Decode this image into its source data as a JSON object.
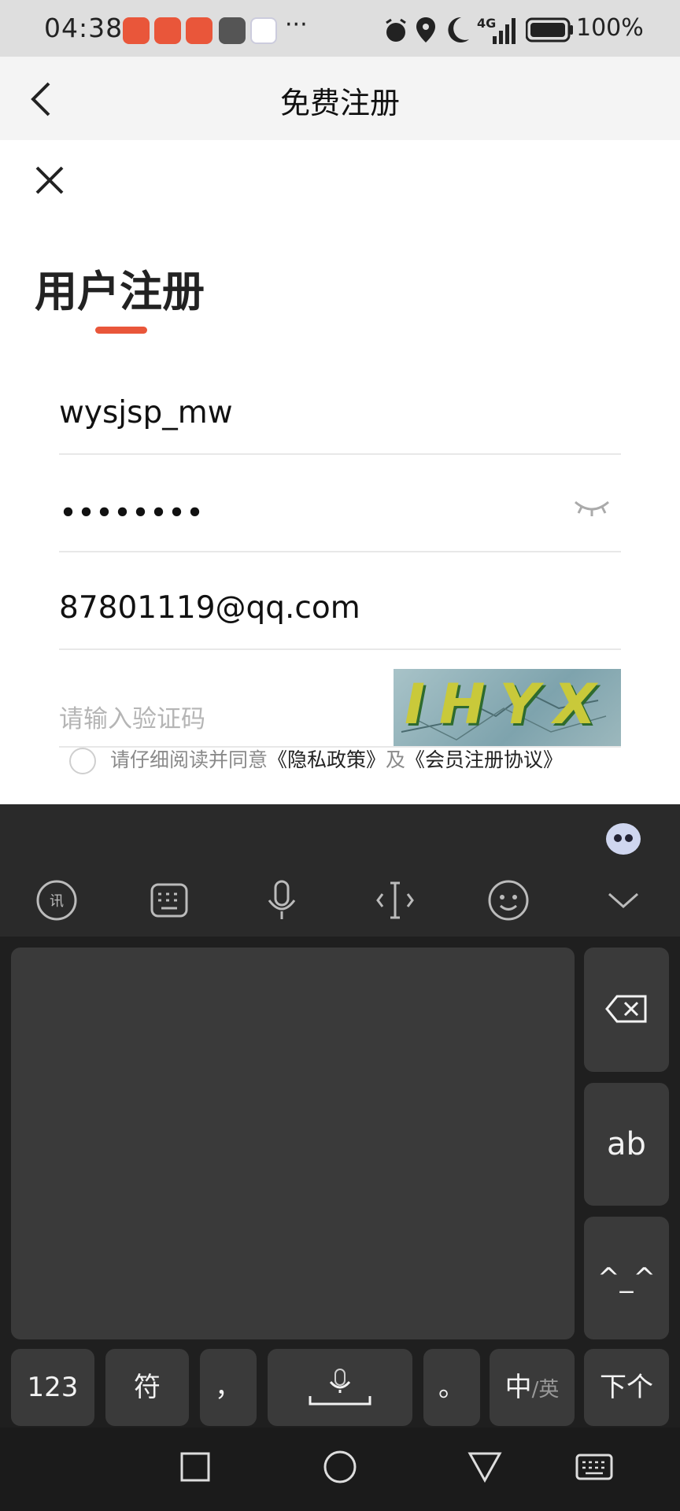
{
  "status_bar": {
    "time": "04:38",
    "more": "···",
    "network": "4G",
    "battery": "100%"
  },
  "title_bar": {
    "back_icon": "back-arrow-icon",
    "title": "免费注册"
  },
  "form": {
    "heading": "用户注册",
    "username": "wysjsp_mw",
    "password": "••••••••",
    "email": "87801119@qq.com",
    "captcha_placeholder": "请输入验证码",
    "captcha_text": "IHYX",
    "agreement": {
      "prefix": "请仔细阅读并同意",
      "privacy": "《隐私政策》",
      "and": "及",
      "member": "《会员注册协议》"
    }
  },
  "keyboard": {
    "toolbar": [
      "iflytek-icon",
      "keyboard-layout-icon",
      "microphone-icon",
      "cursor-icon",
      "emoji-icon",
      "collapse-icon"
    ],
    "keys": {
      "ab": "ab",
      "emoticon": "^_^",
      "num": "123",
      "symbol": "符",
      "comma": "，",
      "period": "。",
      "lang_primary": "中",
      "lang_secondary": "/英",
      "next": "下个"
    }
  },
  "colors": {
    "accent": "#e9563a",
    "keyboard_bg": "#2a2a2a",
    "key_bg": "#3a3a3a"
  }
}
